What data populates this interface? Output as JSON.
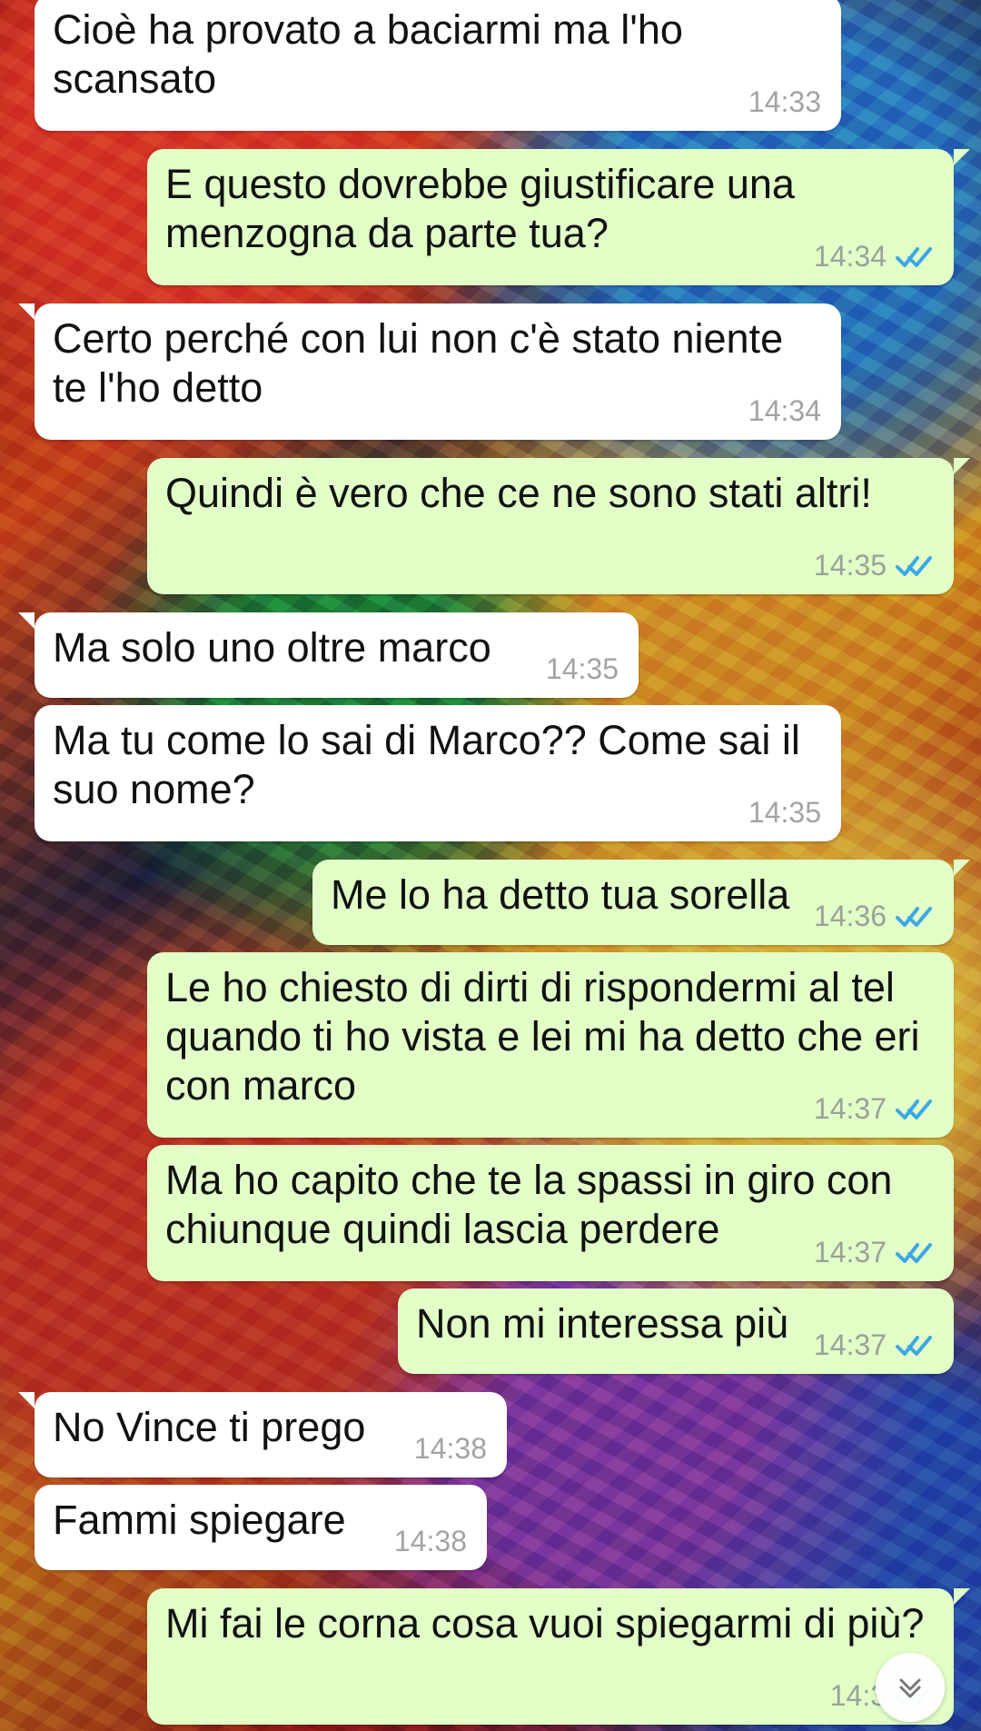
{
  "theme": {
    "incoming_bubble": "#ffffff",
    "outgoing_bubble": "#e1ffc7",
    "read_receipt": "#3ca7e7"
  },
  "messages": [
    {
      "text": "Cioè ha provato a baciarmi ma l'ho\nscansato",
      "time": "14:33"
    },
    {
      "text": "E questo dovrebbe giustificare una\nmenzogna da parte tua?",
      "time": "14:34",
      "status_icon": "double-check-icon"
    },
    {
      "text": "Certo perché con lui non c'è stato niente\nte l'ho detto",
      "time": "14:34"
    },
    {
      "text": "Quindi è vero che ce ne sono stati altri!",
      "time": "14:35",
      "status_icon": "double-check-icon"
    },
    {
      "text": "Ma solo uno oltre marco",
      "time": "14:35"
    },
    {
      "text": "Ma tu come lo sai di Marco?? Come sai il\nsuo nome?",
      "time": "14:35"
    },
    {
      "text": "Me lo ha detto tua sorella",
      "time": "14:36",
      "status_icon": "double-check-icon"
    },
    {
      "text": "Le ho chiesto di dirti di rispondermi al tel\nquando ti ho vista e lei mi ha detto che eri\ncon marco",
      "time": "14:37",
      "status_icon": "double-check-icon"
    },
    {
      "text": "Ma ho capito che te la spassi in giro con\nchiunque quindi lascia perdere",
      "time": "14:37",
      "status_icon": "double-check-icon"
    },
    {
      "text": "Non mi interessa più",
      "time": "14:37",
      "status_icon": "double-check-icon"
    },
    {
      "text": "No Vince ti prego",
      "time": "14:38"
    },
    {
      "text": "Fammi spiegare",
      "time": "14:38"
    },
    {
      "text": "Mi fai le corna cosa vuoi spiegarmi di più?",
      "time": "14:3",
      "status_icon": "double-check-icon"
    }
  ],
  "controls": {
    "scroll_down_icon": "chevrons-down-icon"
  }
}
